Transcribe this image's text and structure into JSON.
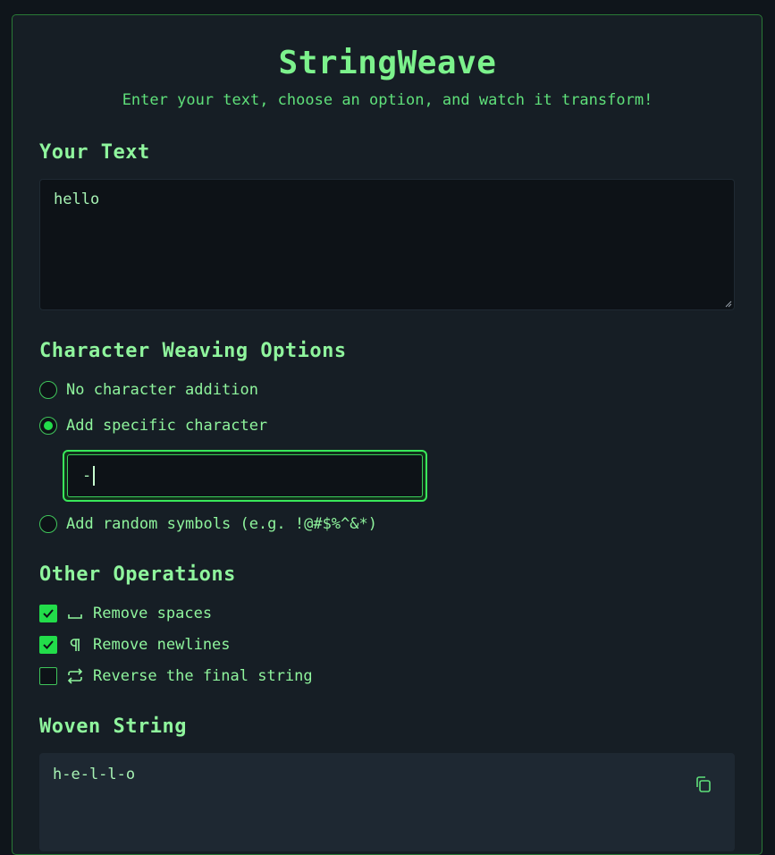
{
  "header": {
    "title": "StringWeave",
    "subtitle": "Enter your text, choose an option, and watch it transform!"
  },
  "input_section": {
    "heading": "Your Text",
    "value": "hello"
  },
  "weaving": {
    "heading": "Character Weaving Options",
    "options": [
      {
        "label": "No character addition",
        "selected": false
      },
      {
        "label": "Add specific character",
        "selected": true
      },
      {
        "label": "Add random symbols (e.g. !@#$%^&*)",
        "selected": false
      }
    ],
    "specific_char_value": "-"
  },
  "operations": {
    "heading": "Other Operations",
    "items": [
      {
        "label": "Remove spaces",
        "checked": true,
        "icon": "space-icon"
      },
      {
        "label": "Remove newlines",
        "checked": true,
        "icon": "pilcrow-icon"
      },
      {
        "label": "Reverse the final string",
        "checked": false,
        "icon": "reverse-arrows-icon"
      }
    ]
  },
  "result": {
    "heading": "Woven String",
    "value": "h-e-l-l-o",
    "copy_icon": "copy-icon"
  },
  "colors": {
    "accent": "#22dd4a",
    "text": "#8ff59d",
    "panel_bg": "#161e25",
    "page_bg": "#0f151b"
  }
}
